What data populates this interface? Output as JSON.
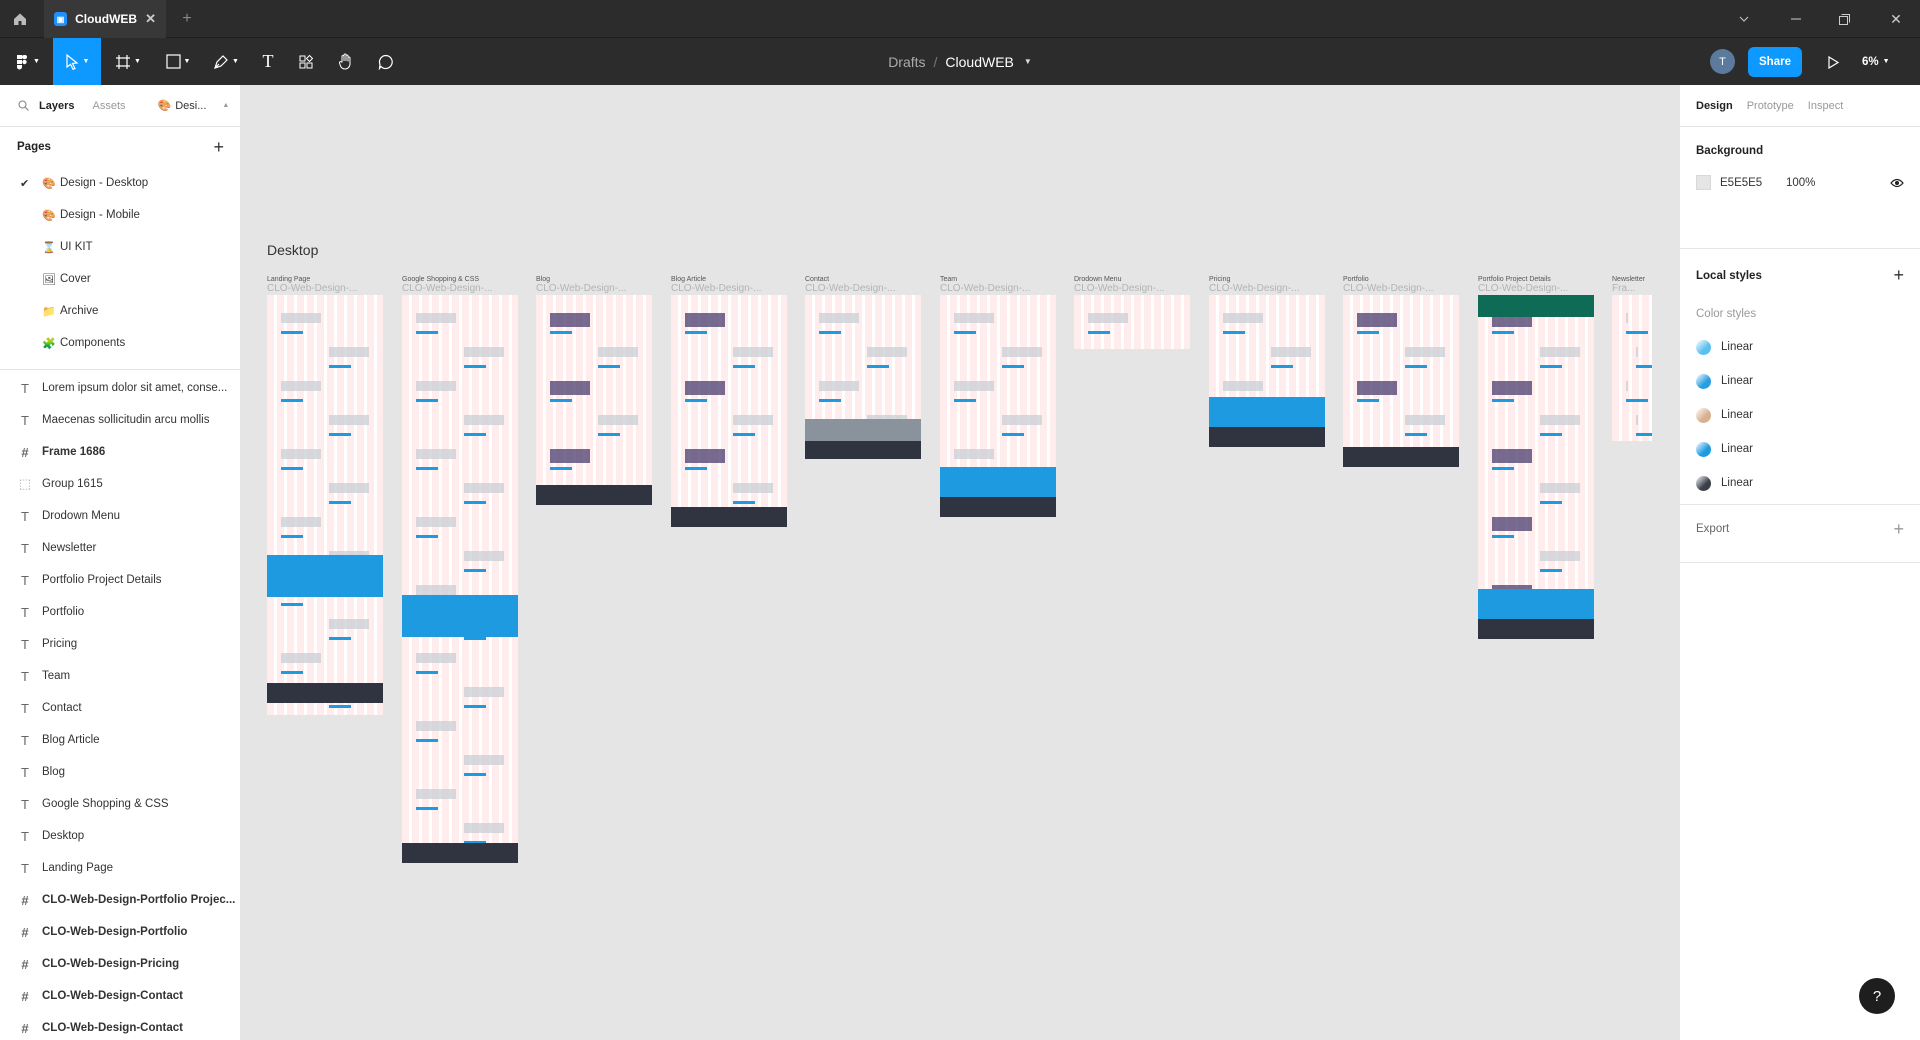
{
  "tabbar": {
    "home_icon": "home-icon",
    "tab_title": "CloudWEB",
    "new_tab": "+"
  },
  "toolbar": {
    "breadcrumb_parent": "Drafts",
    "breadcrumb_sep": "/",
    "file_name": "CloudWEB",
    "avatar_initial": "T",
    "share_label": "Share",
    "zoom": "6%"
  },
  "left": {
    "tabs": {
      "layers": "Layers",
      "assets": "Assets",
      "page_pill": "Desi..."
    },
    "pages_title": "Pages",
    "pages": [
      {
        "label": "Design - Desktop",
        "icon": "🎨",
        "current": true
      },
      {
        "label": "Design - Mobile",
        "icon": "🎨",
        "current": false
      },
      {
        "label": "UI KIT",
        "icon": "⌛",
        "current": false
      },
      {
        "label": "Cover",
        "icon": "🖼",
        "current": false
      },
      {
        "label": "Archive",
        "icon": "📁",
        "current": false
      },
      {
        "label": "Components",
        "icon": "🧩",
        "current": false
      }
    ],
    "layers": [
      {
        "label": "Lorem ipsum dolor sit amet, conse...",
        "type": "text"
      },
      {
        "label": "Maecenas sollicitudin arcu mollis",
        "type": "text"
      },
      {
        "label": "Frame 1686",
        "type": "frame"
      },
      {
        "label": "Group 1615",
        "type": "group"
      },
      {
        "label": "Drodown Menu",
        "type": "text"
      },
      {
        "label": "Newsletter",
        "type": "text"
      },
      {
        "label": "Portfolio Project Details",
        "type": "text"
      },
      {
        "label": "Portfolio",
        "type": "text"
      },
      {
        "label": "Pricing",
        "type": "text"
      },
      {
        "label": "Team",
        "type": "text"
      },
      {
        "label": "Contact",
        "type": "text"
      },
      {
        "label": "Blog Article",
        "type": "text"
      },
      {
        "label": "Blog",
        "type": "text"
      },
      {
        "label": "Google Shopping & CSS",
        "type": "text"
      },
      {
        "label": "Desktop",
        "type": "text"
      },
      {
        "label": "Landing Page",
        "type": "text"
      },
      {
        "label": "CLO-Web-Design-Portfolio Projec...",
        "type": "frame"
      },
      {
        "label": "CLO-Web-Design-Portfolio",
        "type": "frame"
      },
      {
        "label": "CLO-Web-Design-Pricing",
        "type": "frame"
      },
      {
        "label": "CLO-Web-Design-Contact",
        "type": "frame"
      },
      {
        "label": "CLO-Web-Design-Contact",
        "type": "frame"
      }
    ]
  },
  "canvas": {
    "section_label": "Desktop",
    "frames": [
      {
        "title": "Landing Page",
        "name": "CLO-Web-Design-..."
      },
      {
        "title": "Google Shopping & CSS",
        "name": "CLO-Web-Design-..."
      },
      {
        "title": "Blog",
        "name": "CLO-Web-Design-..."
      },
      {
        "title": "Blog Article",
        "name": "CLO-Web-Design-..."
      },
      {
        "title": "Contact",
        "name": "CLO-Web-Design-..."
      },
      {
        "title": "Team",
        "name": "CLO-Web-Design-..."
      },
      {
        "title": "Drodown Menu",
        "name": "CLO-Web-Design-..."
      },
      {
        "title": "Pricing",
        "name": "CLO-Web-Design-..."
      },
      {
        "title": "Portfolio",
        "name": "CLO-Web-Design-..."
      },
      {
        "title": "Portfolio Project Details",
        "name": "CLO-Web-Design-..."
      },
      {
        "title": "Newsletter",
        "name": "Fra..."
      }
    ]
  },
  "right": {
    "tabs": {
      "design": "Design",
      "prototype": "Prototype",
      "inspect": "Inspect"
    },
    "background_title": "Background",
    "bg_hex": "E5E5E5",
    "bg_opacity": "100%",
    "local_styles_title": "Local styles",
    "color_styles_title": "Color styles",
    "color_styles": [
      {
        "label": "Linear",
        "color": "#5bc0f0"
      },
      {
        "label": "Linear",
        "color": "#2a9de0"
      },
      {
        "label": "Linear",
        "color": "#d8b090"
      },
      {
        "label": "Linear",
        "color": "#1e9ae0"
      },
      {
        "label": "Linear",
        "color": "#3a3f4a"
      }
    ],
    "export_title": "Export",
    "help": "?"
  },
  "colors": {
    "accent": "#0d99ff",
    "chrome": "#2c2c2c",
    "canvas": "#e5e5e5",
    "site_blue": "#1e9ae0",
    "site_dark": "#2f3440"
  }
}
